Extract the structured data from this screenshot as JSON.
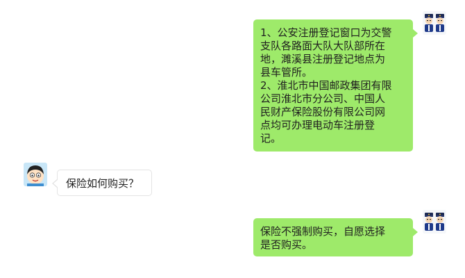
{
  "chat": {
    "messages": [
      {
        "sender": "agent",
        "avatar_icon": "police-avatar-icon",
        "bubble_color": "#9eea6a",
        "lines": [
          "1、公安注册登记窗口为交警",
          "支队各路面大队大队部所在",
          "地，濉溪县注册登记地点为",
          "县车管所。",
          "2、淮北市中国邮政集团有限",
          "公司淮北市分公司、中国人",
          "民财产保险股份有限公司网",
          "点均可办理电动车注册登",
          "记。"
        ]
      },
      {
        "sender": "user",
        "avatar_icon": "cartoon-boy-avatar-icon",
        "bubble_color": "#ffffff",
        "lines": [
          "保险如何购买？"
        ]
      },
      {
        "sender": "agent",
        "avatar_icon": "police-avatar-icon",
        "bubble_color": "#9eea6a",
        "lines": [
          "保险不强制购买，自愿选择",
          "是否购买。"
        ]
      }
    ]
  }
}
